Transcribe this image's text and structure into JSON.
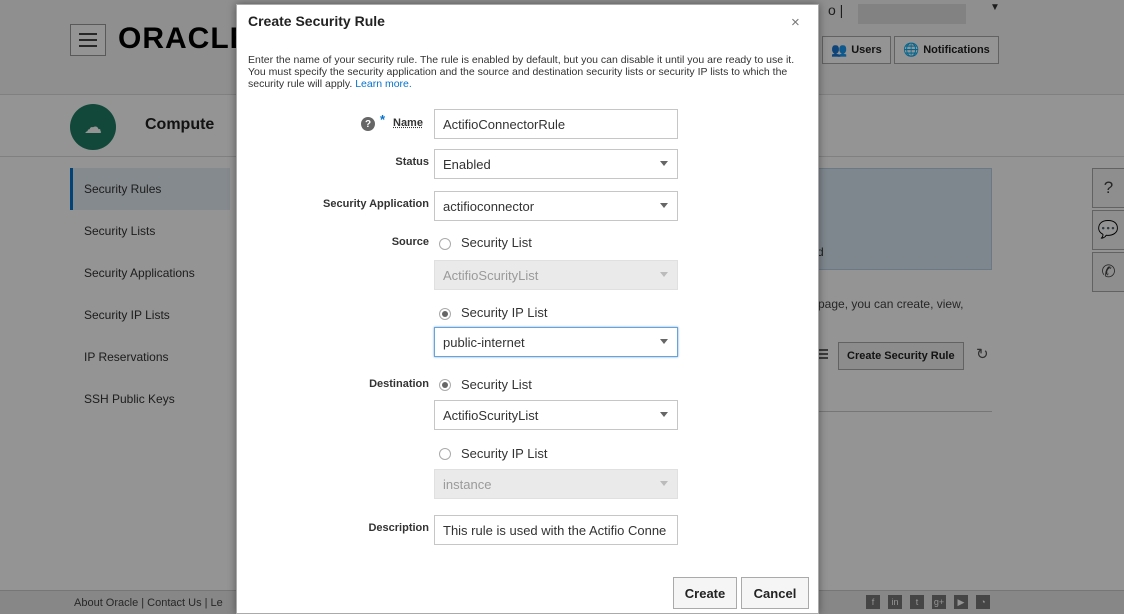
{
  "header": {
    "logo": "ORACLE",
    "user_separator": "o |",
    "users_label": "Users",
    "notifications_label": "Notifications"
  },
  "service": {
    "title": "Compute",
    "icon": "cloud-server-icon"
  },
  "sidebar": {
    "items": [
      {
        "label": "Security Rules",
        "active": true
      },
      {
        "label": "Security Lists"
      },
      {
        "label": "Security Applications"
      },
      {
        "label": "Security IP Lists"
      },
      {
        "label": "IP Reservations"
      },
      {
        "label": "SSH Public Keys"
      }
    ]
  },
  "background": {
    "info_fragment": "d",
    "desc_fragment": "page, you can create, view,",
    "create_rule_button": "Create Security Rule"
  },
  "footer": {
    "links": "About Oracle | Contact Us | Le"
  },
  "dialog": {
    "title": "Create Security Rule",
    "close": "×",
    "intro": "Enter the name of your security rule. The rule is enabled by default, but you can disable it until you are ready to use it. You must specify the security application and the source and destination security lists or security IP lists to which the security rule will apply.",
    "learn_more": "Learn more.",
    "required_mark": "*",
    "name_label": "Name",
    "name_value": "ActifioConnectorRule",
    "status_label": "Status",
    "status_value": "Enabled",
    "app_label": "Security Application",
    "app_value": "actifioconnector",
    "source_label": "Source",
    "source_list_option": "Security List",
    "source_list_value": "ActifioScurityList",
    "source_ip_option": "Security IP List",
    "source_ip_value": "public-internet",
    "destination_label": "Destination",
    "dest_list_option": "Security List",
    "dest_list_value": "ActifioScurityList",
    "dest_ip_option": "Security IP List",
    "dest_ip_value": "instance",
    "description_label": "Description",
    "description_value": "This rule is used with the Actifio Conne",
    "create_button": "Create",
    "cancel_button": "Cancel"
  },
  "colors": {
    "accent": "#0572ce",
    "service_icon_bg": "#1e7d63",
    "overlay": "rgba(0,0,0,0.42)"
  }
}
